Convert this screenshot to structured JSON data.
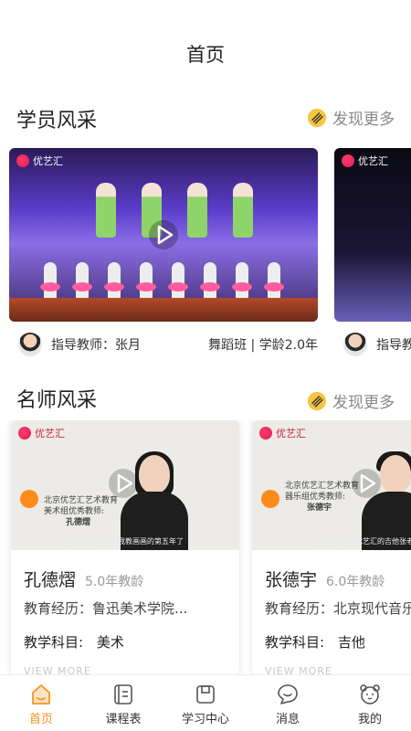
{
  "header": {
    "title": "首页"
  },
  "students_section": {
    "title": "学员风采",
    "more_label": "发现更多",
    "cards": [
      {
        "logo_text": "优艺汇",
        "teacher": "指导教师：张月",
        "class_info": "舞蹈班 | 学龄2.0年"
      },
      {
        "logo_text": "优艺汇",
        "teacher": "指导教师："
      }
    ]
  },
  "teachers_section": {
    "title": "名师风采",
    "more_label": "发现更多",
    "cards": [
      {
        "name": "孔德熠",
        "years": "5.0年教龄",
        "experience": "教育经历：鲁迅美术学院...",
        "subject_label": "教学科目:",
        "subject": "美术",
        "view_more": "VIEW MORE",
        "org_line1": "北京优艺汇艺术教育",
        "org_line2": "美术组优秀教师:",
        "org_name": "孔德熠",
        "caption": "到今年，已经是我教画画的第五年了"
      },
      {
        "name": "张德宇",
        "years": "6.0年教龄",
        "experience": "教育经历：北京现代音乐",
        "subject_label": "教学科目:",
        "subject": "吉他",
        "view_more": "VIEW MORE",
        "org_line1": "北京优艺汇艺术教育",
        "org_line2": "器乐组优秀教师:",
        "org_name": "张德宇",
        "caption": "大家好，我是优艺汇的吉他张老师"
      }
    ]
  },
  "tabbar": {
    "items": [
      {
        "label": "首页",
        "icon": "home-icon",
        "active": true
      },
      {
        "label": "课程表",
        "icon": "schedule-icon",
        "active": false
      },
      {
        "label": "学习中心",
        "icon": "study-center-icon",
        "active": false
      },
      {
        "label": "消息",
        "icon": "message-icon",
        "active": false
      },
      {
        "label": "我的",
        "icon": "profile-icon",
        "active": false
      }
    ]
  },
  "colors": {
    "accent": "#f7941d",
    "highlight": "#ff9a3c",
    "text": "#222222",
    "muted": "#888888"
  }
}
